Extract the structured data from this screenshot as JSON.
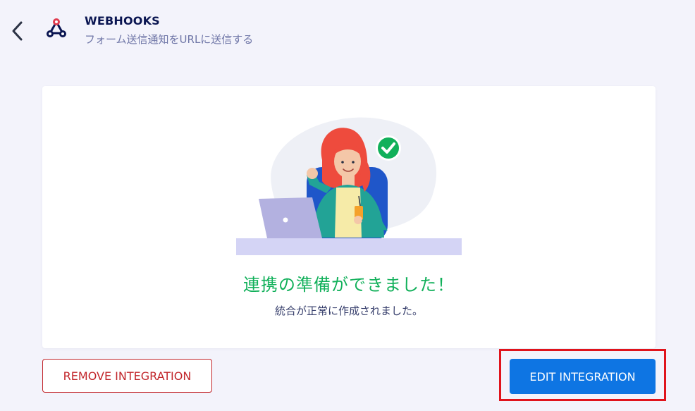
{
  "header": {
    "back_icon": "chevron-left-icon",
    "app_icon": "webhook-icon",
    "title": "WEBHOOKS",
    "subtitle": "フォーム送信通知をURLに送信する"
  },
  "success_card": {
    "illustration": "woman-thumbs-up-laptop-check-illustration",
    "heading": "連携の準備ができました！",
    "message": "統合が正常に作成されました。"
  },
  "actions": {
    "remove_label": "REMOVE INTEGRATION",
    "edit_label": "EDIT INTEGRATION"
  },
  "colors": {
    "background": "#f3f3fb",
    "title": "#0a1551",
    "success": "#11b05a",
    "danger": "#c2262b",
    "primary": "#0e75e3",
    "highlight": "#e0141c"
  }
}
